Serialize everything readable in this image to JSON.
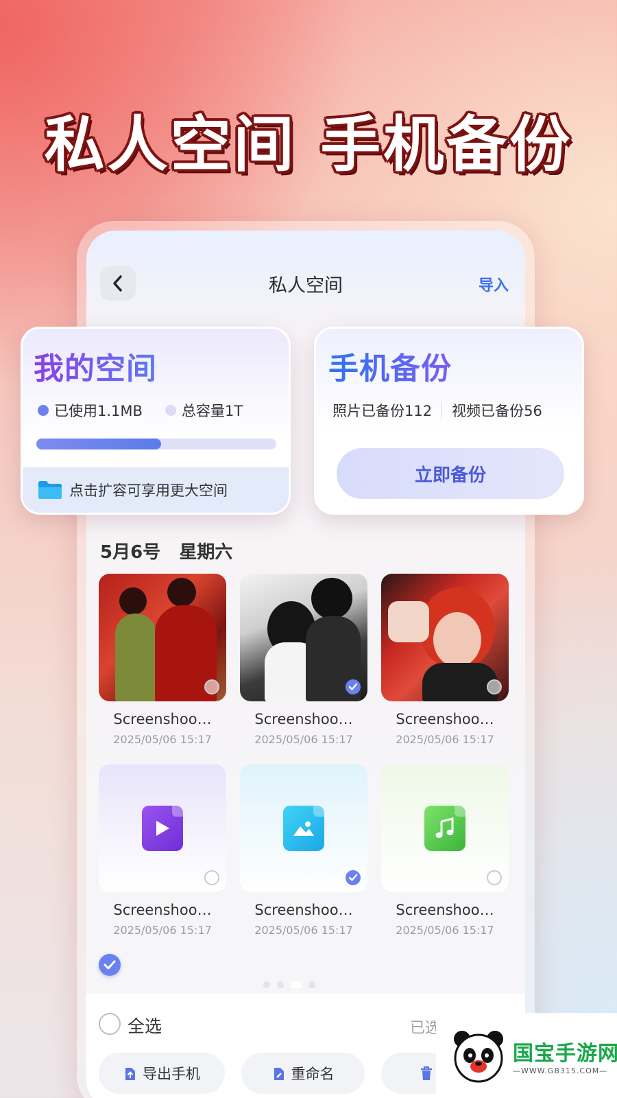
{
  "headline": "私人空间 手机备份",
  "nav": {
    "title": "私人空间",
    "import_label": "导入"
  },
  "my_space": {
    "title": "我的空间",
    "used_label": "已使用1.1MB",
    "total_label": "总容量1T",
    "usage_progress": 0.52,
    "expand_text": "点击扩容可享用更大空间"
  },
  "phone_backup": {
    "title": "手机备份",
    "photos_label": "照片已备份112",
    "videos_label": "视频已备份56",
    "button_label": "立即备份"
  },
  "date_header": "5月6号   星期六",
  "items": [
    {
      "name": "Screenshoo…",
      "date": "2025/05/06 15:17",
      "kind": "image",
      "selected": false
    },
    {
      "name": "Screenshoo…",
      "date": "2025/05/06 15:17",
      "kind": "image",
      "selected": true
    },
    {
      "name": "Screenshoo…",
      "date": "2025/05/06 15:17",
      "kind": "image",
      "selected": false
    },
    {
      "name": "Screenshoo…",
      "date": "2025/05/06 15:17",
      "kind": "video-file",
      "selected": false
    },
    {
      "name": "Screenshoo…",
      "date": "2025/05/06 15:17",
      "kind": "image-file",
      "selected": true
    },
    {
      "name": "Screenshoo…",
      "date": "2025/05/06 15:17",
      "kind": "audio-file",
      "selected": false
    }
  ],
  "bottom": {
    "select_all_label": "全选",
    "selected_count": "已选",
    "actions": [
      {
        "label": "导出手机",
        "icon": "export-icon"
      },
      {
        "label": "重命名",
        "icon": "rename-icon"
      },
      {
        "label": "",
        "icon": "delete-icon"
      }
    ]
  },
  "watermark": {
    "name": "国宝手游网",
    "url": "—WWW.GB315.COM—"
  },
  "colors": {
    "accent": "#6b82ee",
    "link": "#3d6ef0",
    "headline_stroke": "#7d1212"
  }
}
